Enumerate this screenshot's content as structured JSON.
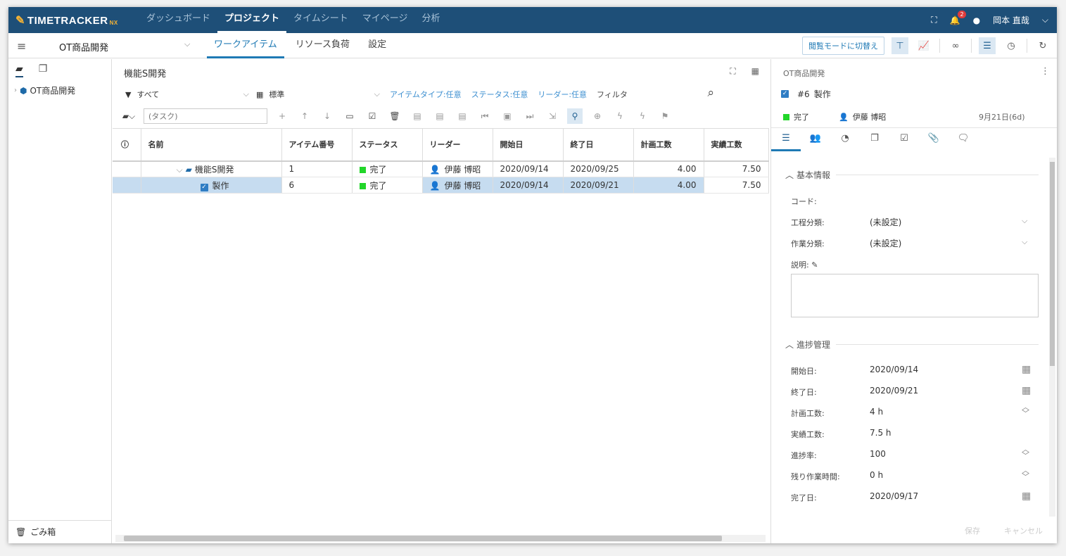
{
  "app": {
    "logo_text": "TIMETRACKER",
    "logo_suffix": "NX",
    "nav": [
      {
        "label": "ダッシュボード"
      },
      {
        "label": "プロジェクト"
      },
      {
        "label": "タイムシート"
      },
      {
        "label": "マイページ"
      },
      {
        "label": "分析"
      }
    ],
    "notification_count": "2",
    "user_name": "岡本 直哉"
  },
  "subbar": {
    "project_name": "OT商品開発",
    "tabs": [
      {
        "label": "ワークアイテム"
      },
      {
        "label": "リソース負荷"
      },
      {
        "label": "設定"
      }
    ],
    "view_mode_button": "閲覧モードに切替え"
  },
  "left": {
    "tree_root": "OT商品開発",
    "trash_label": "ごみ箱"
  },
  "center": {
    "title": "機能S開発",
    "filter_all": "すべて",
    "view_std": "標準",
    "filters": [
      {
        "label": "アイテムタイプ:任意"
      },
      {
        "label": "ステータス:任意"
      },
      {
        "label": "リーダー:任意"
      }
    ],
    "filter_label": "フィルタ",
    "task_placeholder": "(タスク)",
    "columns": {
      "name": "名前",
      "item_no": "アイテム番号",
      "status": "ステータス",
      "leader": "リーダー",
      "start": "開始日",
      "end": "終了日",
      "plan": "計画工数",
      "actual": "実績工数"
    },
    "rows": [
      {
        "name": "機能S開発",
        "item_no": "1",
        "status": "完了",
        "leader": "伊藤 博昭",
        "start": "2020/09/14",
        "end": "2020/09/25",
        "plan": "4.00",
        "actual": "7.50"
      },
      {
        "name": "製作",
        "item_no": "6",
        "status": "完了",
        "leader": "伊藤 博昭",
        "start": "2020/09/14",
        "end": "2020/09/21",
        "plan": "4.00",
        "actual": "7.50"
      }
    ]
  },
  "detail": {
    "breadcrumb": "OT商品開発",
    "item_id": "#6",
    "item_name": "製作",
    "status": "完了",
    "leader": "伊藤 博昭",
    "date_info": "9月21日(6d)",
    "section_basic": "基本情報",
    "code_label": "コード:",
    "process_label": "工程分類:",
    "process_value": "(未設定)",
    "work_label": "作業分類:",
    "work_value": "(未設定)",
    "desc_label": "説明:",
    "section_progress": "進捗管理",
    "start_label": "開始日:",
    "start_value": "2020/09/14",
    "end_label": "終了日:",
    "end_value": "2020/09/21",
    "plan_label": "計画工数:",
    "plan_value": "4 h",
    "actual_label": "実績工数:",
    "actual_value": "7.5 h",
    "rate_label": "進捗率:",
    "rate_value": "100",
    "remain_label": "残り作業時間:",
    "remain_value": "0 h",
    "done_label": "完了日:",
    "done_value": "2020/09/17",
    "save_label": "保存",
    "cancel_label": "キャンセル"
  }
}
